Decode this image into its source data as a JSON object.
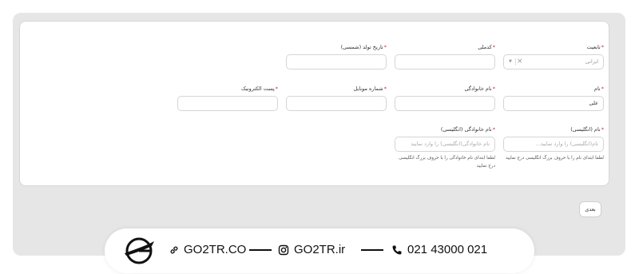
{
  "form": {
    "fields": [
      {
        "key": "nationality",
        "label": "تابعیت",
        "required": true,
        "type": "select",
        "value": "ایرانی"
      },
      {
        "key": "national_code",
        "label": "کدملی",
        "required": true,
        "type": "input",
        "value": "",
        "placeholder": ""
      },
      {
        "key": "birth_date",
        "label": "تاریخ تولد (شمسی)",
        "required": true,
        "type": "input",
        "value": "",
        "placeholder": ""
      },
      {
        "key": "first_name",
        "label": "نام",
        "required": true,
        "type": "input",
        "value": "علی",
        "placeholder": ""
      },
      {
        "key": "last_name",
        "label": "نام خانوادگی",
        "required": true,
        "type": "input",
        "value": "",
        "placeholder": ""
      },
      {
        "key": "mobile",
        "label": "شماره موبایل",
        "required": true,
        "type": "input",
        "value": "",
        "placeholder": ""
      },
      {
        "key": "email",
        "label": "پست الکترونیک",
        "required": true,
        "type": "input",
        "value": "",
        "placeholder": ""
      },
      {
        "key": "first_name_en",
        "label": "نام (انگلیسی)",
        "required": true,
        "type": "input",
        "value": "",
        "placeholder": "نام(انگلیسی) را وارد نمایید...",
        "help": "لطفا ابتدای نام را با حروف بزرگ انگلیسی درج نمایید"
      },
      {
        "key": "last_name_en",
        "label": "نام خانوادگی (انگلیسی)",
        "required": true,
        "type": "input",
        "value": "",
        "placeholder": "نام خانوادگی(انگلیسی) را وارد نمایید",
        "help": "لطفا ابتدای نام خانوادگی را با حروف بزرگ انگلیسی درج نمایید"
      }
    ],
    "required_mark": "*",
    "next_button": "بعدی"
  },
  "banner": {
    "website": "GO2TR.CO",
    "instagram": "GO2TR.ir",
    "phone": "021 43000 021",
    "icons": [
      "link-icon",
      "instagram-icon",
      "phone-icon"
    ]
  },
  "colors": {
    "required": "#d12b2b",
    "frame": "#e6e6e6"
  }
}
